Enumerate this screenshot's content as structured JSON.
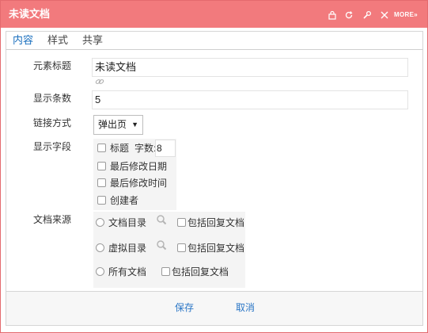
{
  "dialog": {
    "title": "未读文档",
    "more_label": "MORE»",
    "icons": [
      "lock-icon",
      "refresh-icon",
      "settings-icon",
      "close-icon"
    ]
  },
  "tabs": [
    {
      "label": "内容",
      "active": true
    },
    {
      "label": "样式",
      "active": false
    },
    {
      "label": "共享",
      "active": false
    }
  ],
  "form": {
    "title_label": "元素标题",
    "title_value": "未读文档",
    "count_label": "显示条数",
    "count_value": "5",
    "link_label": "链接方式",
    "link_value": "弹出页",
    "fields_label": "显示字段",
    "fields": {
      "title_option": "标题",
      "chars_label": "字数:",
      "chars_value": "8",
      "modified_date": "最后修改日期",
      "modified_time": "最后修改时间",
      "creator": "创建者"
    },
    "source_label": "文档来源",
    "sources": [
      {
        "label": "文档目录",
        "include_label": "包括回复文档"
      },
      {
        "label": "虚拟目录",
        "include_label": "包括回复文档"
      },
      {
        "label": "所有文档",
        "include_label": "包括回复文档"
      }
    ]
  },
  "footer": {
    "save_label": "保存",
    "cancel_label": "取消"
  },
  "colors": {
    "titlebar": "#f27a7d",
    "accent_link": "#2a76c6"
  }
}
